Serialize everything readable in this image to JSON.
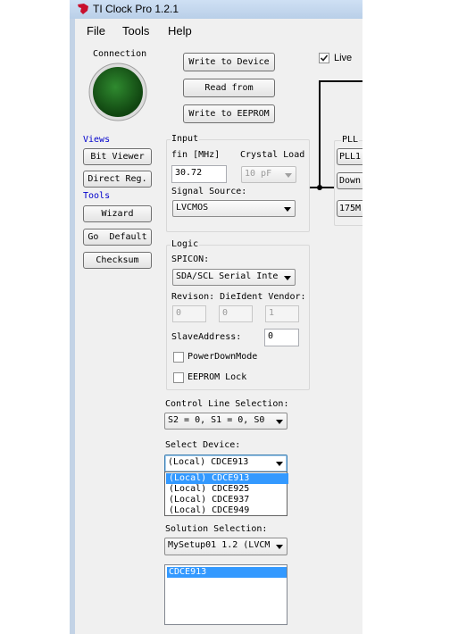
{
  "window": {
    "title": "TI Clock Pro 1.2.1"
  },
  "menu": [
    "File",
    "Tools",
    "Help"
  ],
  "connection": {
    "label": "Connection",
    "status_color": "#1c5c1c"
  },
  "device_buttons": {
    "write_device": "Write to Device",
    "read_from": "Read from",
    "write_eeprom": "Write to EEPROM"
  },
  "live": {
    "label": "Live ",
    "checked": true
  },
  "views": {
    "label": "Views",
    "bit_viewer": "Bit Viewer",
    "direct_reg": "Direct Reg."
  },
  "tools": {
    "label": "Tools",
    "wizard": "Wizard",
    "go_default": "Go  Default",
    "checksum": "Checksum"
  },
  "input": {
    "title": "Input",
    "fin_label": "fin [MHz]",
    "fin_value": "30.72",
    "crystal_label": "Crystal Load",
    "crystal_value": "10 pF",
    "signal_label": "Signal Source:",
    "signal_value": "LVCMOS"
  },
  "logic": {
    "title": "Logic",
    "spicon_label": "SPICON:",
    "spicon_value": "SDA/SCL Serial Inte",
    "id_labels": "Revison: DieIdent Vendor:",
    "revision": "0",
    "dieident": "0",
    "vendor": "1",
    "slave_label": "SlaveAddress:",
    "slave_value": "0",
    "powerdown": "PowerDownMode",
    "eeprom_lock": "EEPROM Lock"
  },
  "control_line": {
    "label": "Control Line Selection:",
    "value": "S2 = 0, S1 = 0, S0"
  },
  "select_device": {
    "label": "Select Device:",
    "value": "(Local) CDCE913",
    "options": [
      "(Local) CDCE913",
      "(Local) CDCE925",
      "(Local) CDCE937",
      "(Local) CDCE949"
    ],
    "highlighted": "(Local) CDCE913"
  },
  "solution": {
    "label": "Solution Selection:",
    "value": "MySetup01 1.2 (LVCM",
    "list": [
      "CDCE913"
    ]
  },
  "pll": {
    "title": "PLL",
    "pll_select": "PLL1",
    "down_label": "Down",
    "freq_label": "175M"
  }
}
